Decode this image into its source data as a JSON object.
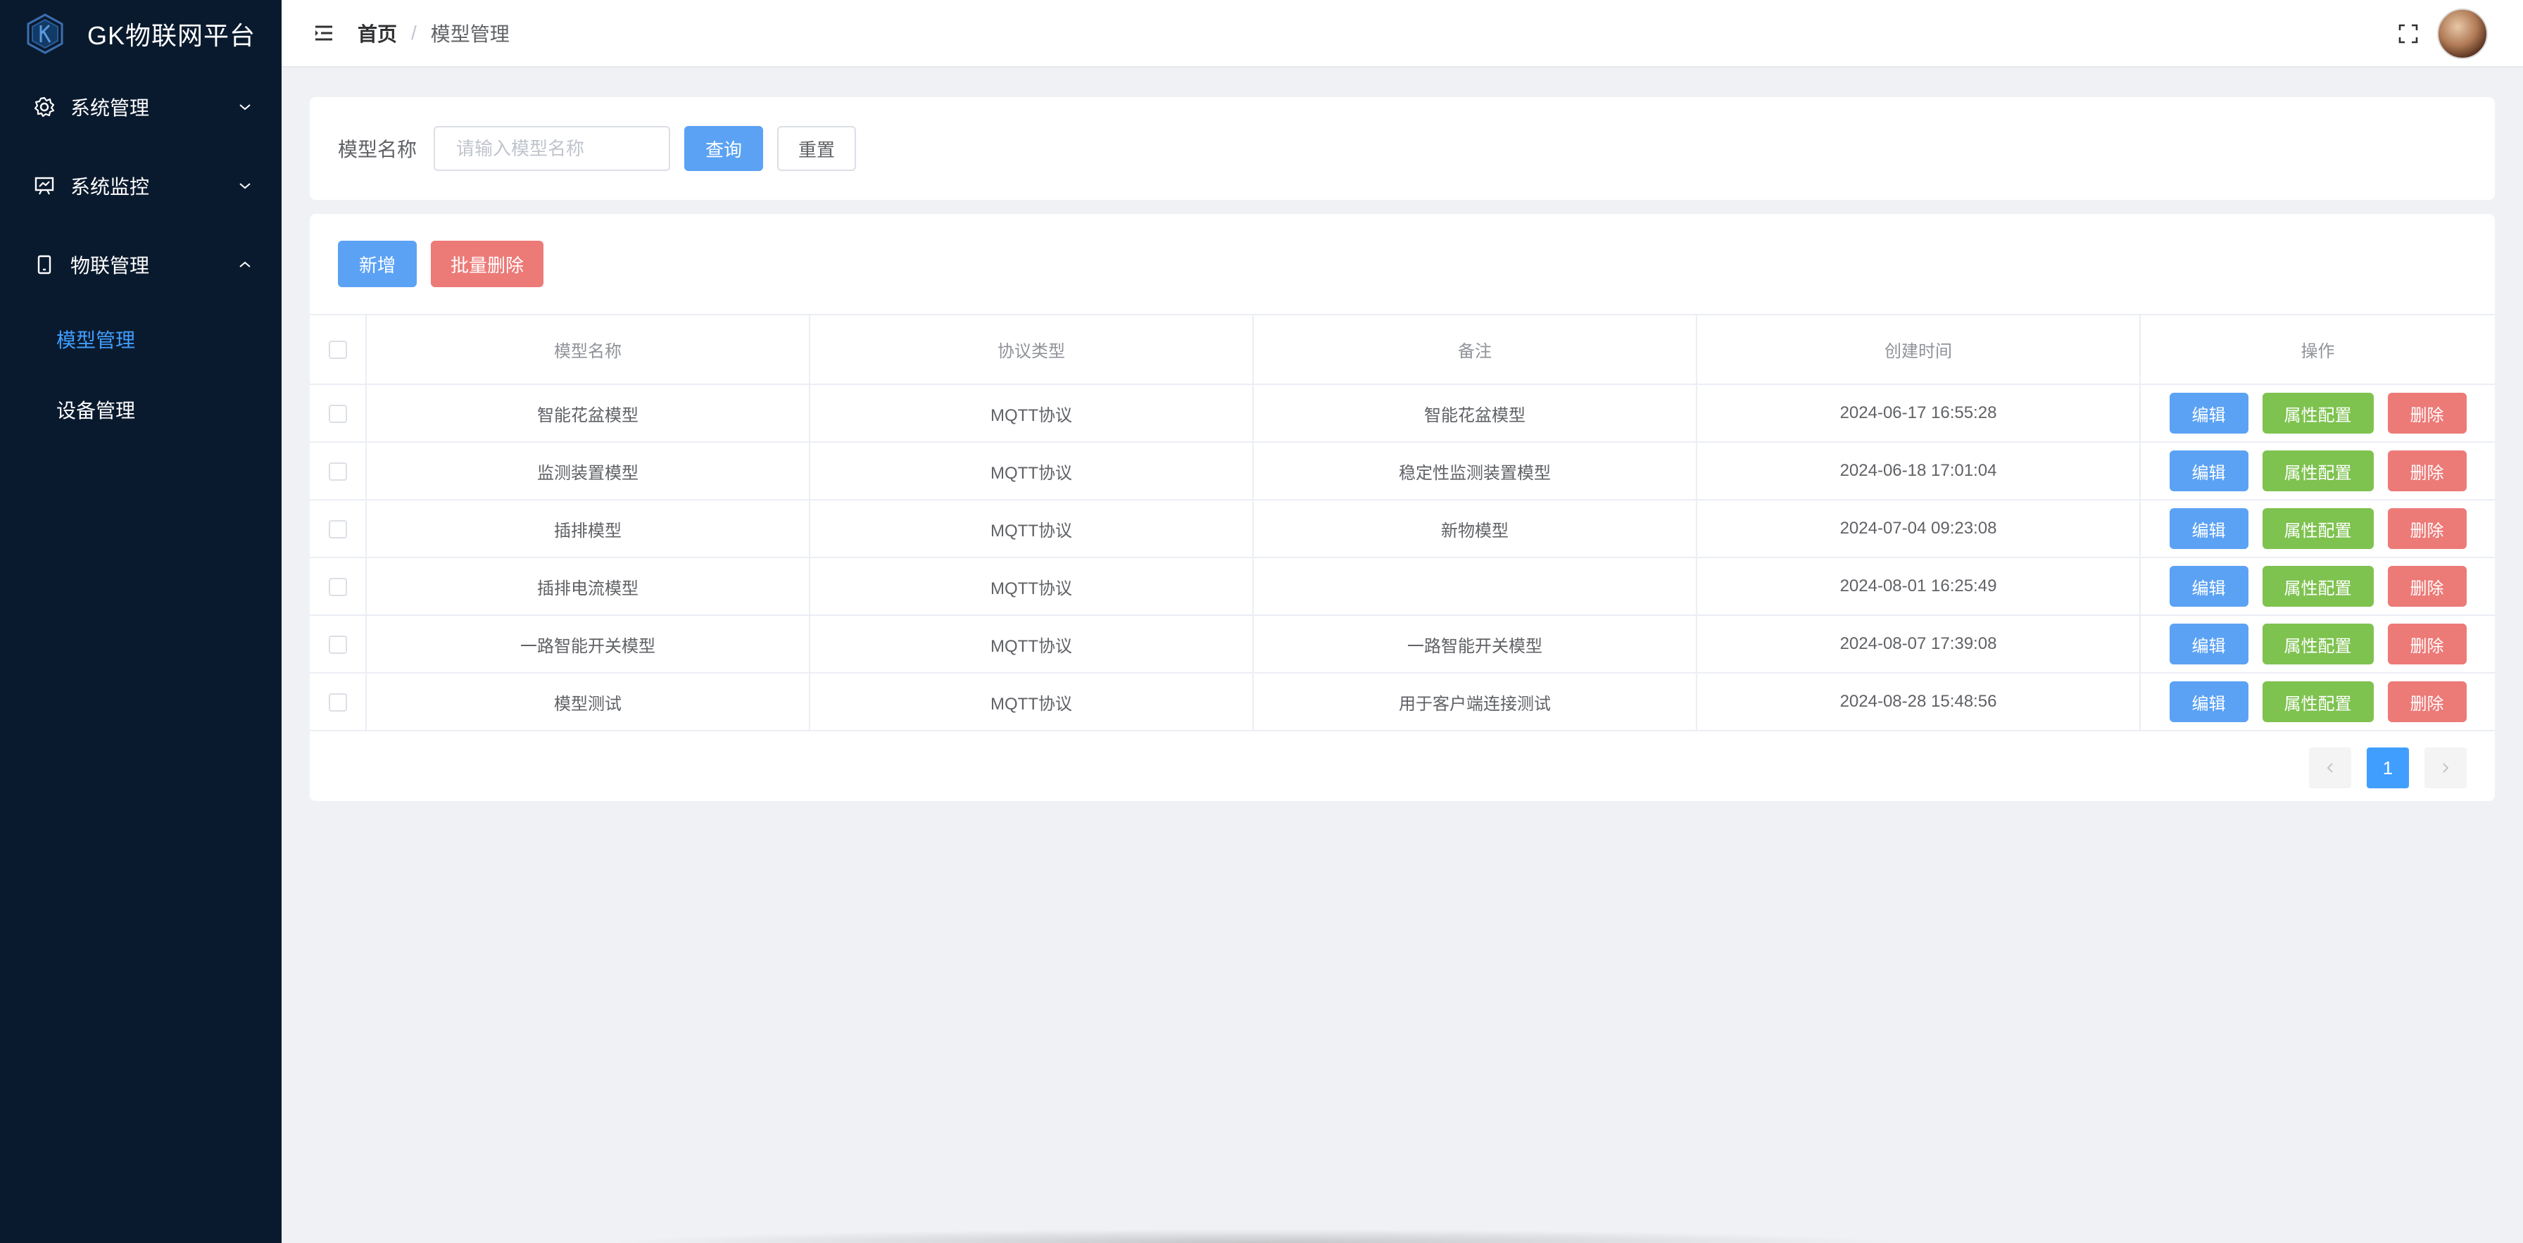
{
  "app": {
    "title": "GK物联网平台"
  },
  "sidebar": {
    "menus": [
      {
        "label": "系统管理",
        "icon": "gear-icon",
        "expanded": false
      },
      {
        "label": "系统监控",
        "icon": "monitor-icon",
        "expanded": false
      },
      {
        "label": "物联管理",
        "icon": "phone-icon",
        "expanded": true
      }
    ],
    "submenu": [
      {
        "label": "模型管理",
        "active": true
      },
      {
        "label": "设备管理",
        "active": false
      }
    ]
  },
  "header": {
    "breadcrumb": {
      "home": "首页",
      "separator": "/",
      "current": "模型管理"
    }
  },
  "search": {
    "label": "模型名称",
    "placeholder": "请输入模型名称",
    "value": "",
    "query_label": "查询",
    "reset_label": "重置"
  },
  "toolbar": {
    "add_label": "新增",
    "batch_delete_label": "批量删除"
  },
  "table": {
    "columns": [
      "模型名称",
      "协议类型",
      "备注",
      "创建时间",
      "操作"
    ],
    "rows": [
      {
        "name": "智能花盆模型",
        "protocol": "MQTT协议",
        "remark": "智能花盆模型",
        "created": "2024-06-17 16:55:28"
      },
      {
        "name": "监测装置模型",
        "protocol": "MQTT协议",
        "remark": "稳定性监测装置模型",
        "created": "2024-06-18 17:01:04"
      },
      {
        "name": "插排模型",
        "protocol": "MQTT协议",
        "remark": "新物模型",
        "created": "2024-07-04 09:23:08"
      },
      {
        "name": "插排电流模型",
        "protocol": "MQTT协议",
        "remark": "",
        "created": "2024-08-01 16:25:49"
      },
      {
        "name": "一路智能开关模型",
        "protocol": "MQTT协议",
        "remark": "一路智能开关模型",
        "created": "2024-08-07 17:39:08"
      },
      {
        "name": "模型测试",
        "protocol": "MQTT协议",
        "remark": "用于客户端连接测试",
        "created": "2024-08-28 15:48:56"
      }
    ],
    "actions": {
      "edit": "编辑",
      "attr_config": "属性配置",
      "delete": "删除"
    }
  },
  "pagination": {
    "current_page": "1"
  },
  "colors": {
    "sidebar_bg": "#0a1a2e",
    "primary": "#5ba2f4",
    "success": "#7ec24f",
    "danger": "#ec7a77",
    "active_menu": "#409eff"
  }
}
